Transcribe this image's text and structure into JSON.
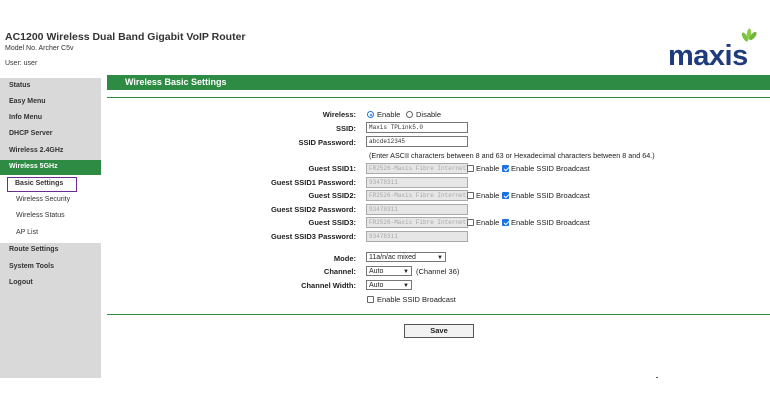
{
  "header": {
    "product_title": "AC1200 Wireless Dual Band Gigabit VoIP Router",
    "model": "Model No. Archer C5v",
    "user": "User:  user",
    "logo_text": "maxis",
    "brand_color": "#1e3c7c",
    "accent_green": "#2e8b43"
  },
  "sidebar": {
    "items": [
      {
        "label": "Status"
      },
      {
        "label": "Easy Menu"
      },
      {
        "label": "Info Menu"
      },
      {
        "label": "DHCP Server"
      },
      {
        "label": "Wireless 2.4GHz"
      },
      {
        "label": "Wireless 5GHz"
      },
      {
        "label": "Basic Settings"
      },
      {
        "label": "Wireless Security"
      },
      {
        "label": "Wireless Status"
      },
      {
        "label": "AP List"
      },
      {
        "label": "Route Settings"
      },
      {
        "label": "System Tools"
      },
      {
        "label": "Logout"
      }
    ]
  },
  "page": {
    "title": "Wireless Basic Settings",
    "wireless_label": "Wireless:",
    "enable_label": "Enable",
    "disable_label": "Disable",
    "ssid_label": "SSID:",
    "ssid_value": "Maxis TPLink5.0",
    "ssid_password_label": "SSID Password:",
    "ssid_password_value": "abcde12345",
    "password_hint": "(Enter ASCII characters between 8 and 63 or Hexadecimal characters between 8 and 64.)",
    "guest": [
      {
        "ssid_label": "Guest SSID1:",
        "ssid_value": "FR2526-Maxis Fibre Internet",
        "pw_label": "Guest SSID1 Password:",
        "pw_value": "93478311",
        "enable_label": "Enable",
        "broadcast_label": "Enable SSID Broadcast"
      },
      {
        "ssid_label": "Guest SSID2:",
        "ssid_value": "FR2526-Maxis Fibre Internet",
        "pw_label": "Guest SSID2 Password:",
        "pw_value": "93478311",
        "enable_label": "Enable",
        "broadcast_label": "Enable SSID Broadcast"
      },
      {
        "ssid_label": "Guest SSID3:",
        "ssid_value": "FR2526-Maxis Fibre Internet",
        "pw_label": "Guest SSID3 Password:",
        "pw_value": "93478311",
        "enable_label": "Enable",
        "broadcast_label": "Enable SSID Broadcast"
      }
    ],
    "mode_label": "Mode:",
    "mode_value": "11a/n/ac mixed",
    "channel_label": "Channel:",
    "channel_value": "Auto",
    "channel_note": "(Channel 36)",
    "channel_width_label": "Channel Width:",
    "channel_width_value": "Auto",
    "broadcast_label": "Enable SSID Broadcast",
    "save_label": "Save"
  }
}
